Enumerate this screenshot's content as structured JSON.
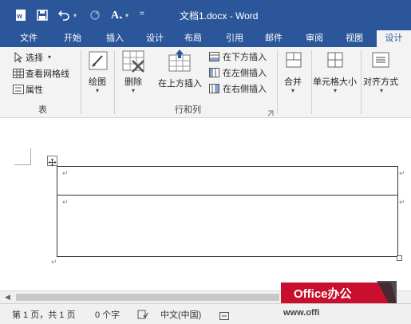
{
  "titlebar": {
    "title": "文档1.docx - Word",
    "word_icon": "word-icon",
    "qat": [
      "save-icon",
      "undo-icon",
      "redo-icon",
      "format-painter-icon",
      "customize-qat-icon"
    ]
  },
  "tabs": [
    "文件",
    "开始",
    "插入",
    "设计",
    "布局",
    "引用",
    "邮件",
    "审阅",
    "视图",
    "设计"
  ],
  "ribbon": {
    "table_group": {
      "select": "选择",
      "view_gridlines": "查看网格线",
      "properties": "属性",
      "label": "表"
    },
    "draw": "绘图",
    "delete": "删除",
    "insert_above": "在上方插入",
    "insert_below": "在下方插入",
    "insert_left": "在左侧插入",
    "insert_right": "在右侧插入",
    "rows_cols_label": "行和列",
    "merge": "合并",
    "cell_size": "单元格大小",
    "alignment": "对齐方式"
  },
  "document": {
    "table_rows": 2
  },
  "status": {
    "page": "第 1 页，共 1 页",
    "words": "0 个字",
    "language": "中文(中国)"
  },
  "watermark": {
    "text": "Office办公",
    "url": "www.offi"
  }
}
